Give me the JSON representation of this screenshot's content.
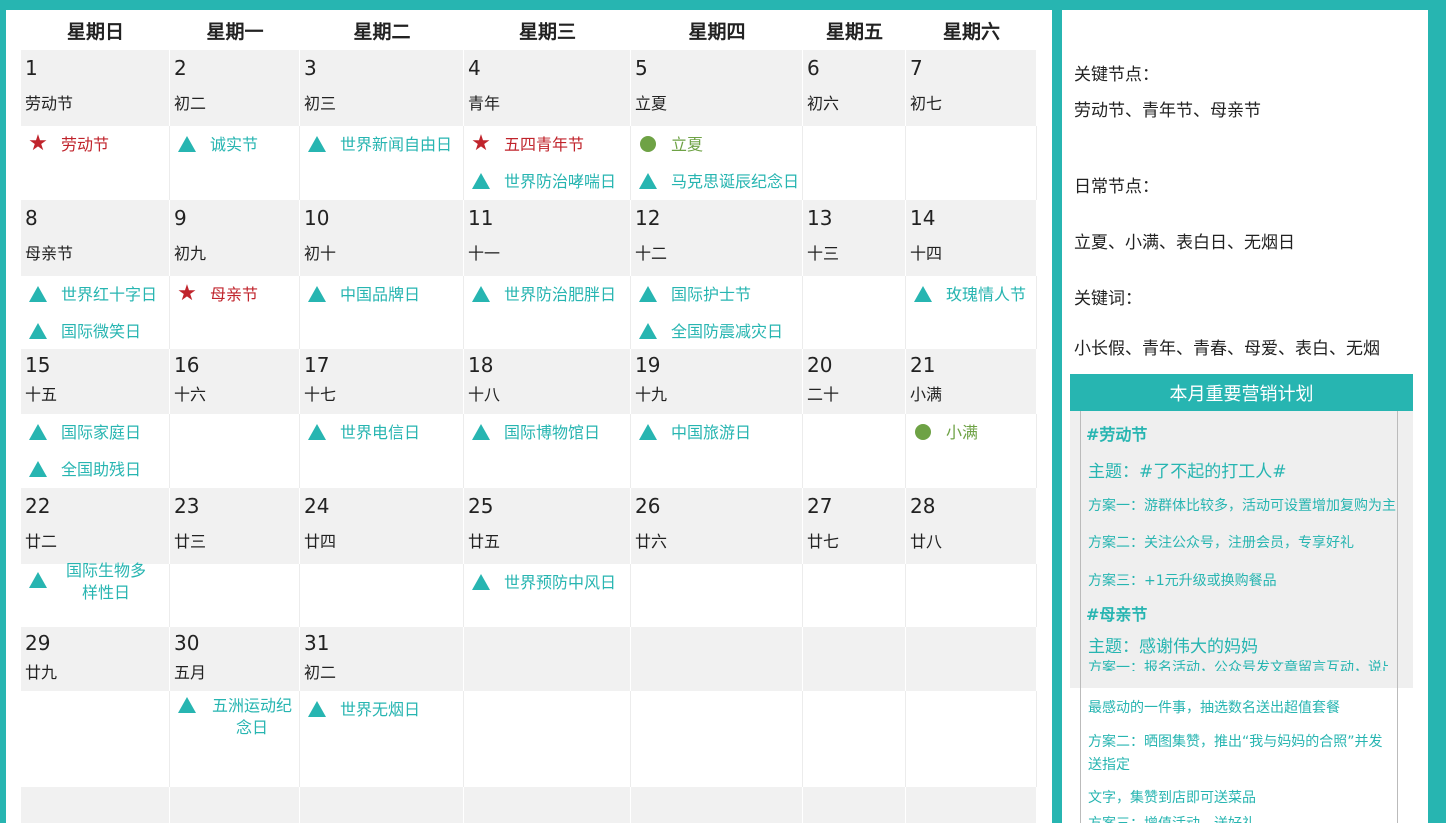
{
  "weekdays": [
    "星期日",
    "星期一",
    "星期二",
    "星期三",
    "星期四",
    "星期五",
    "星期六"
  ],
  "weeks": [
    {
      "days": [
        {
          "num": "1",
          "lunar": "劳动节"
        },
        {
          "num": "2",
          "lunar": "初二"
        },
        {
          "num": "3",
          "lunar": "初三"
        },
        {
          "num": "4",
          "lunar": "青年"
        },
        {
          "num": "5",
          "lunar": "立夏"
        },
        {
          "num": "6",
          "lunar": "初六"
        },
        {
          "num": "7",
          "lunar": "初七"
        }
      ]
    },
    {
      "days": [
        {
          "num": "8",
          "lunar": "母亲节"
        },
        {
          "num": "9",
          "lunar": "初九"
        },
        {
          "num": "10",
          "lunar": "初十"
        },
        {
          "num": "11",
          "lunar": "十一"
        },
        {
          "num": "12",
          "lunar": "十二"
        },
        {
          "num": "13",
          "lunar": "十三"
        },
        {
          "num": "14",
          "lunar": "十四"
        }
      ]
    },
    {
      "days": [
        {
          "num": "15",
          "lunar": "十五"
        },
        {
          "num": "16",
          "lunar": "十六"
        },
        {
          "num": "17",
          "lunar": "十七"
        },
        {
          "num": "18",
          "lunar": "十八"
        },
        {
          "num": "19",
          "lunar": "十九"
        },
        {
          "num": "20",
          "lunar": "二十"
        },
        {
          "num": "21",
          "lunar": "小满"
        }
      ]
    },
    {
      "days": [
        {
          "num": "22",
          "lunar": "廿二"
        },
        {
          "num": "23",
          "lunar": "廿三"
        },
        {
          "num": "24",
          "lunar": "廿四"
        },
        {
          "num": "25",
          "lunar": "廿五"
        },
        {
          "num": "26",
          "lunar": "廿六"
        },
        {
          "num": "27",
          "lunar": "廿七"
        },
        {
          "num": "28",
          "lunar": "廿八"
        }
      ]
    },
    {
      "days": [
        {
          "num": "29",
          "lunar": "廿九"
        },
        {
          "num": "30",
          "lunar": "五月"
        },
        {
          "num": "31",
          "lunar": "初二"
        },
        {
          "num": "",
          "lunar": ""
        },
        {
          "num": "",
          "lunar": ""
        },
        {
          "num": "",
          "lunar": ""
        },
        {
          "num": "",
          "lunar": ""
        }
      ]
    }
  ],
  "events": {
    "w1": [
      "劳动节",
      "诚实节",
      "世界新闻自由日",
      "五四青年节",
      "世界防治哮喘日",
      "立夏",
      "马克思诞辰纪念日"
    ],
    "w2": [
      "世界红十字日",
      "国际微笑日",
      "母亲节",
      "中国品牌日",
      "世界防治肥胖日",
      "国际护士节",
      "全国防震减灾日",
      "玫瑰情人节"
    ],
    "w3": [
      "国际家庭日",
      "全国助残日",
      "世界电信日",
      "国际博物馆日",
      "中国旅游日",
      "小满"
    ],
    "w4": [
      "国际生物多样性日",
      "世界预防中风日"
    ],
    "w5": [
      "五洲运动纪念日",
      "世界无烟日"
    ]
  },
  "sidebar": {
    "key_label": "关键节点：",
    "key_value": "劳动节、青年节、母亲节",
    "daily_label": "日常节点：",
    "daily_value": "立夏、小满、表白日、无烟日",
    "kw_label": "关键词：",
    "kw_value": "小长假、青年、青春、母爱、表白、无烟"
  },
  "plan": {
    "title": "本月重要营销计划",
    "lines": [
      "#劳动节",
      "主题：#了不起的打工人#",
      "方案一：游群体比较多，活动可设置增加复购为主",
      "方案二：关注公众号，注册会员，专享好礼",
      "方案三：+1元升级或换购餐品",
      "#母亲节",
      "主题：感谢伟大的妈妈",
      "方案一：报名活动，公众号发文章留言互动，说出母亲",
      "最感动的一件事，抽选数名送出超值套餐",
      "方案二：晒图集赞，推出“我与妈妈的合照”并发送指定",
      "文字，集赞到店即可送菜品",
      "方案三：增值活动，送好礼"
    ]
  },
  "colors": {
    "teal": "#27b5b1",
    "red": "#c0242c",
    "green": "#6ea245",
    "gray": "#f1f1f1"
  }
}
